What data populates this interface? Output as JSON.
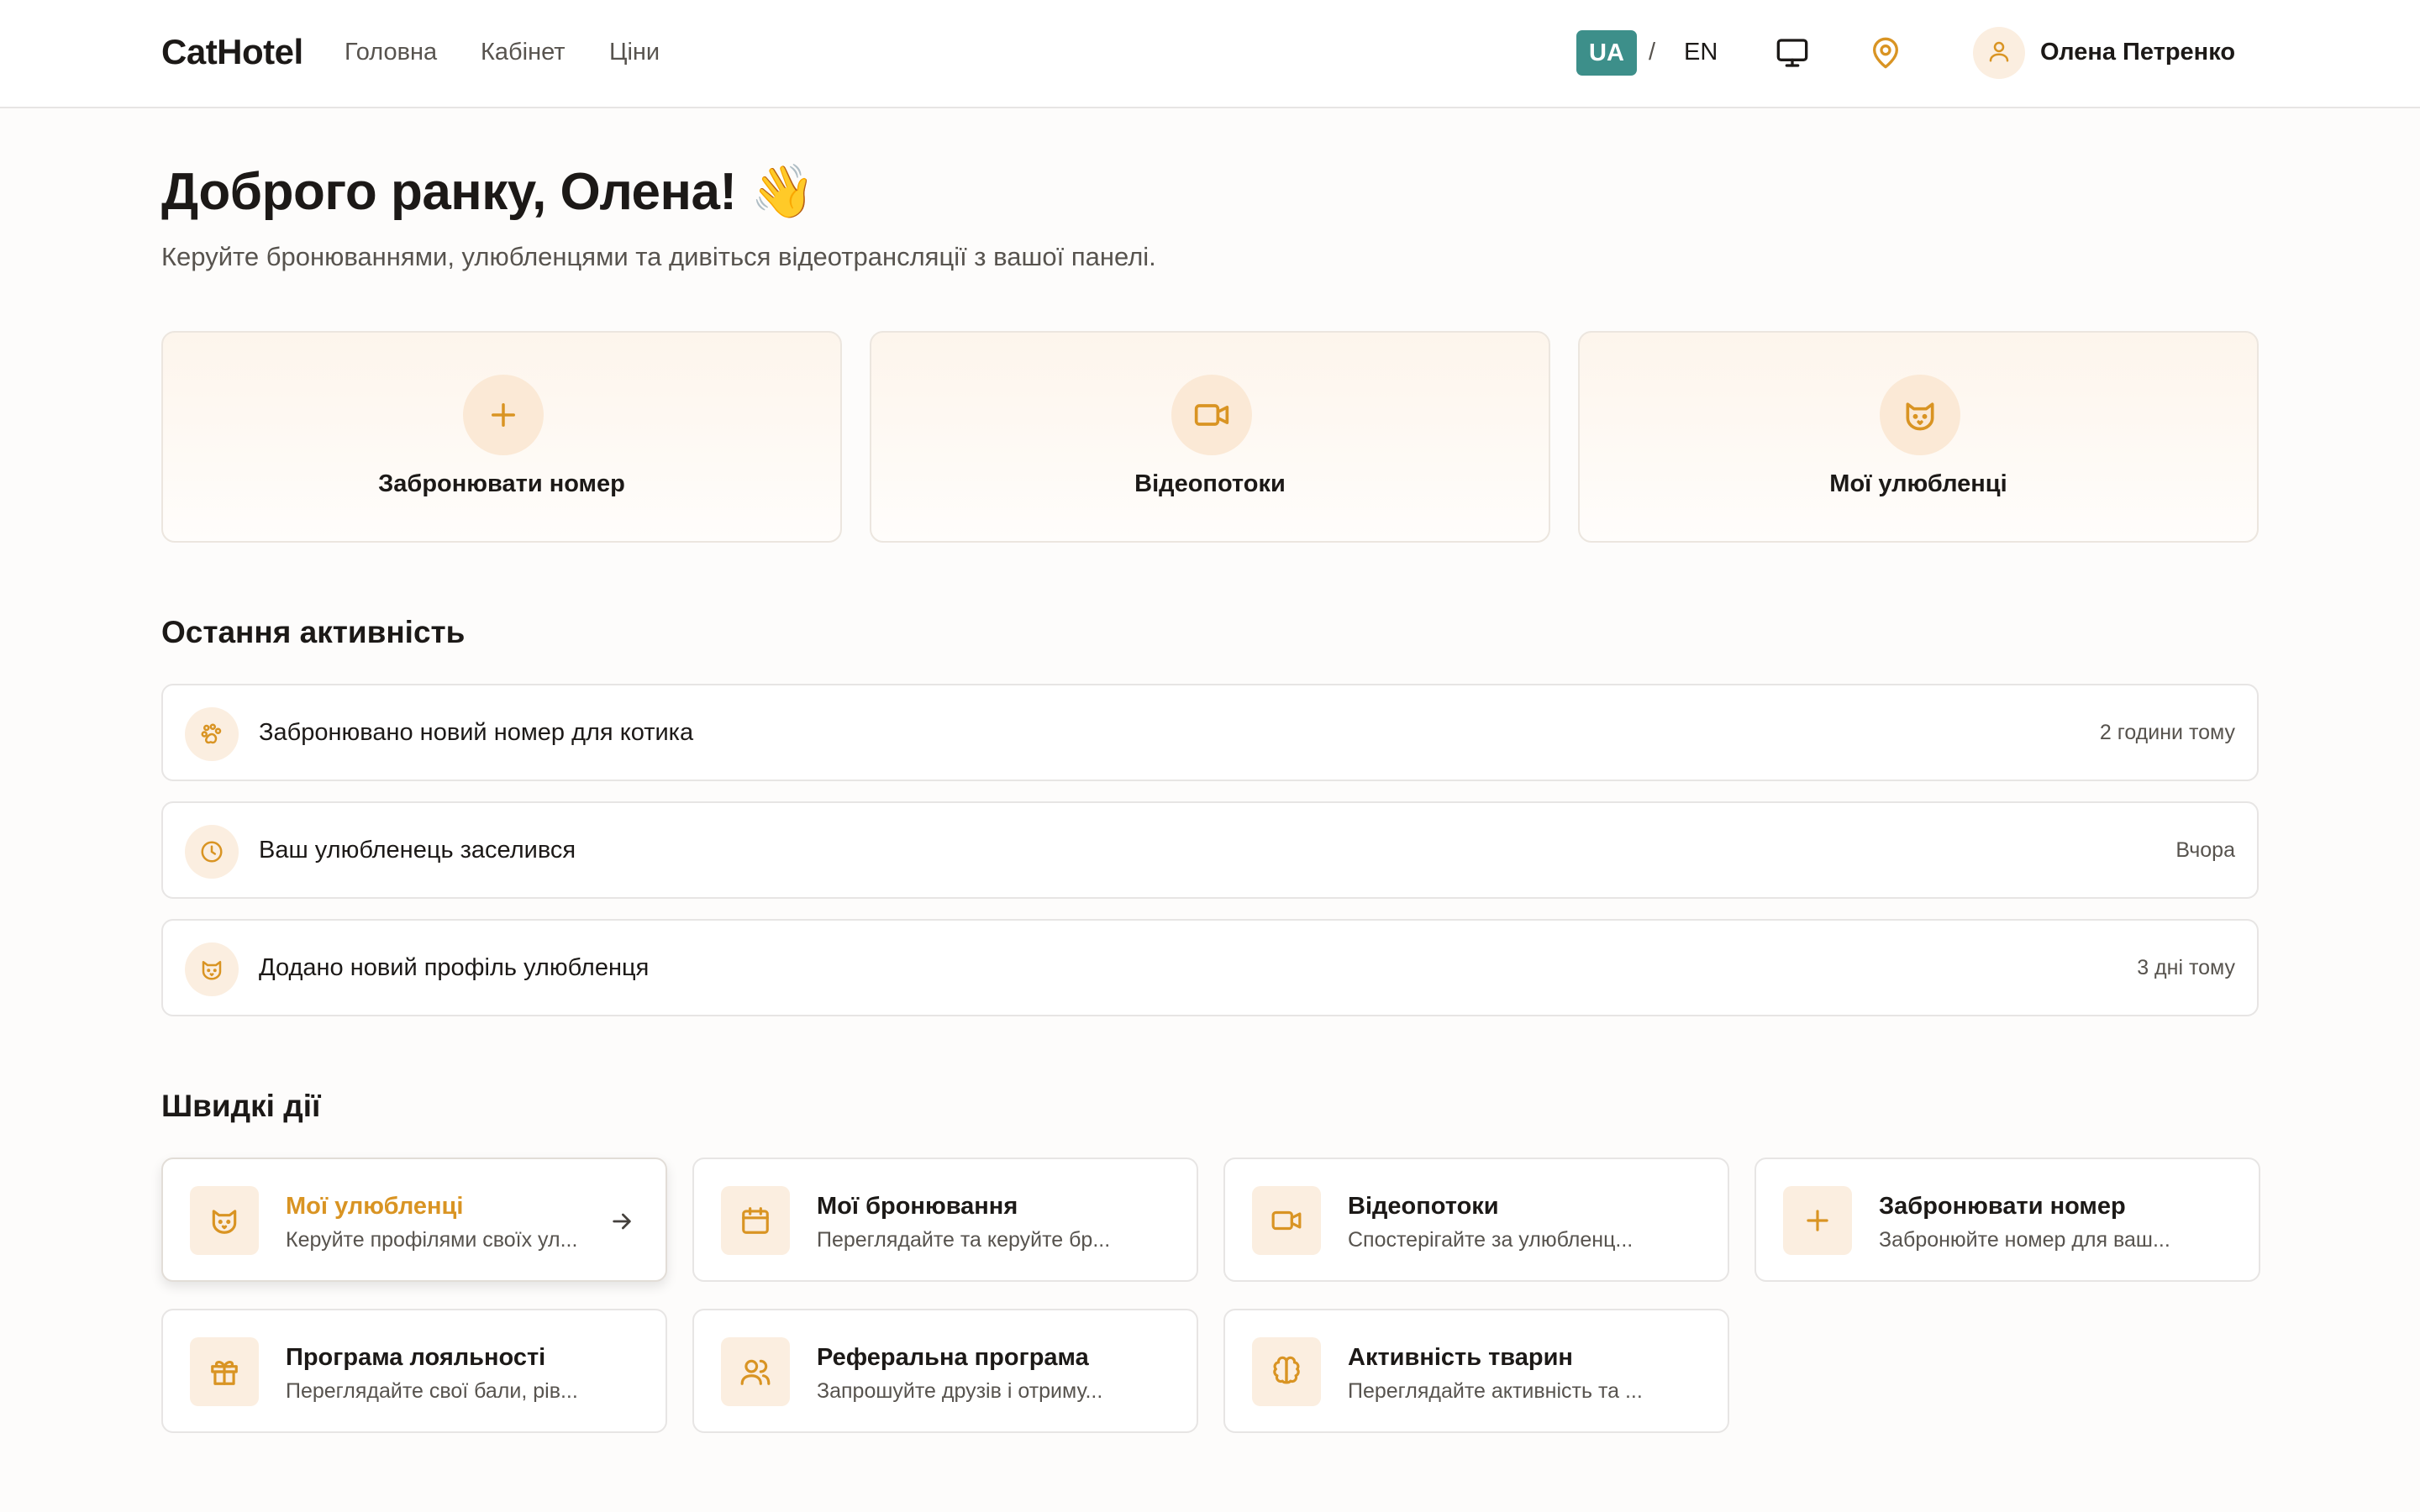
{
  "header": {
    "logo": "CatHotel",
    "nav": [
      "Головна",
      "Кабінет",
      "Ціни"
    ],
    "lang_ua": "UA",
    "lang_sep": "/",
    "lang_en": "EN",
    "user_name": "Олена Петренко",
    "icons": [
      "monitor-icon",
      "map-pin-icon",
      "user-icon"
    ]
  },
  "hero": {
    "greeting": "Доброго ранку, Олена! 👋",
    "subtitle": "Керуйте бронюваннями, улюбленцями та дивіться відеотрансляції з вашої панелі."
  },
  "main_cards": [
    {
      "label": "Забронювати номер",
      "icon": "plus-icon"
    },
    {
      "label": "Відеопотоки",
      "icon": "video-icon"
    },
    {
      "label": "Мої улюбленці",
      "icon": "cat-icon"
    }
  ],
  "activity": {
    "title": "Остання активність",
    "items": [
      {
        "text": "Забронювано новий номер для котика",
        "time": "2 години тому",
        "icon": "paw-icon"
      },
      {
        "text": "Ваш улюбленець заселився",
        "time": "Вчора",
        "icon": "clock-icon"
      },
      {
        "text": "Додано новий профіль улюбленця",
        "time": "3 дні тому",
        "icon": "cat-icon"
      }
    ]
  },
  "quick_actions": {
    "title": "Швидкі дії",
    "items": [
      {
        "title": "Мої улюбленці",
        "desc": "Керуйте профілями своїх ул...",
        "icon": "cat-icon",
        "active": true
      },
      {
        "title": "Мої бронювання",
        "desc": "Переглядайте та керуйте бр...",
        "icon": "calendar-icon"
      },
      {
        "title": "Відеопотоки",
        "desc": "Спостерігайте за улюбленц...",
        "icon": "video-icon"
      },
      {
        "title": "Забронювати номер",
        "desc": "Забронюйте номер для ваш...",
        "icon": "plus-icon"
      },
      {
        "title": "Програма лояльності",
        "desc": "Переглядайте свої бали, рів...",
        "icon": "gift-icon"
      },
      {
        "title": "Реферальна програма",
        "desc": "Запрошуйте друзів і отриму...",
        "icon": "users-icon"
      },
      {
        "title": "Активність тварин",
        "desc": "Переглядайте активність та ...",
        "icon": "brain-icon"
      }
    ]
  },
  "colors": {
    "accent": "#d99423",
    "teal": "#3d8f8a",
    "icon_bg": "#fbeee0"
  }
}
